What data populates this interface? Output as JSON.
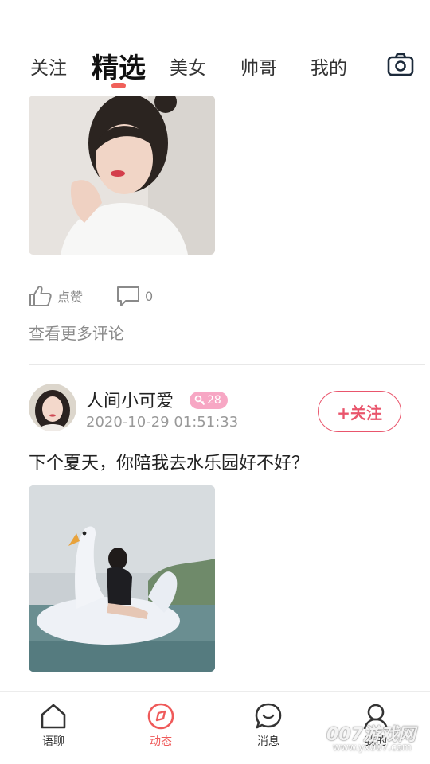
{
  "tabs": [
    {
      "label": "关注",
      "active": false
    },
    {
      "label": "精选",
      "active": true
    },
    {
      "label": "美女",
      "active": false
    },
    {
      "label": "帅哥",
      "active": false
    },
    {
      "label": "我的",
      "active": false
    }
  ],
  "accent_color": "#f0605a",
  "camera_icon": "camera-icon",
  "post1": {
    "like_label": "点赞",
    "comment_count": "0",
    "more_comments": "查看更多评论"
  },
  "post2": {
    "username": "人间小可爱",
    "level": "28",
    "timestamp": "2020-10-29 01:51:33",
    "follow_label": "+关注",
    "text": "下个夏天，你陪我去水乐园好不好？"
  },
  "nav": [
    {
      "label": "语聊",
      "icon": "home-icon",
      "active": false
    },
    {
      "label": "动态",
      "icon": "discover-icon",
      "active": true
    },
    {
      "label": "消息",
      "icon": "chat-icon",
      "active": false
    },
    {
      "label": "我的",
      "icon": "user-icon",
      "active": false
    }
  ],
  "watermark": {
    "text": "007游戏网",
    "url": "www.yx007.com"
  }
}
